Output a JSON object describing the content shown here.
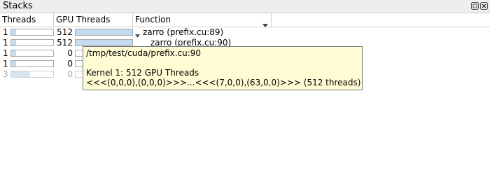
{
  "panel": {
    "title": "Stacks"
  },
  "columns": {
    "threads": "Threads",
    "gpu_threads": "GPU Threads",
    "function": "Function"
  },
  "rows": [
    {
      "threads": "1",
      "thread_fill": 0.12,
      "gpu_threads": "512",
      "gpu_fill": 1.0,
      "function": "zarro (prefix.cu:89)",
      "expanded": true
    },
    {
      "threads": "1",
      "thread_fill": 0.12,
      "gpu_threads": "512",
      "gpu_fill": 1.0,
      "function": "zarro (prefix.cu:90)",
      "expanded": false
    },
    {
      "threads": "1",
      "thread_fill": 0.12,
      "gpu_threads": "0",
      "gpu_fill": 0.0,
      "function": "",
      "expanded": false
    },
    {
      "threads": "1",
      "thread_fill": 0.12,
      "gpu_threads": "0",
      "gpu_fill": 0.0,
      "function": "",
      "expanded": false
    },
    {
      "threads": "3",
      "thread_fill": 0.45,
      "gpu_threads": "0",
      "gpu_fill": 0.0,
      "function": "",
      "expanded": false
    }
  ],
  "tooltip": {
    "path": "/tmp/test/cuda/prefix.cu:90",
    "kernel": "Kernel 1: 512 GPU Threads",
    "range": "<<<(0,0,0),(0,0,0)>>>...<<<(7,0,0),(63,0,0)>>> (512 threads)"
  },
  "colors": {
    "bar_fill": "#c5dcee",
    "tooltip_bg": "#fffcd4"
  }
}
